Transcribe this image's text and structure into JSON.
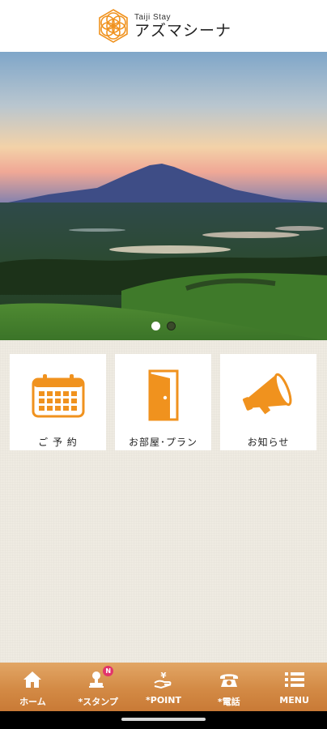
{
  "header": {
    "logo_sub": "Taiji Stay",
    "logo_main": "アズマシーナ"
  },
  "hero": {
    "carousel_slides": 2,
    "active_slide": 1
  },
  "tiles": [
    {
      "label": "ご 予 約",
      "icon": "calendar-icon"
    },
    {
      "label": "お部屋･プラン",
      "icon": "door-icon"
    },
    {
      "label": "お知らせ",
      "icon": "megaphone-icon"
    }
  ],
  "bottom_nav": {
    "items": [
      {
        "label": "ホーム",
        "icon": "home-icon"
      },
      {
        "label": "*スタンプ",
        "icon": "stamp-icon",
        "badge": "N"
      },
      {
        "label": "*POINT",
        "icon": "point-icon"
      },
      {
        "label": "*電話",
        "icon": "phone-icon"
      },
      {
        "label": "MENU",
        "icon": "menu-icon"
      }
    ]
  },
  "colors": {
    "accent": "#f0921e",
    "nav_bg": "#d38a45",
    "badge": "#e2336b",
    "background": "#efebe2"
  }
}
